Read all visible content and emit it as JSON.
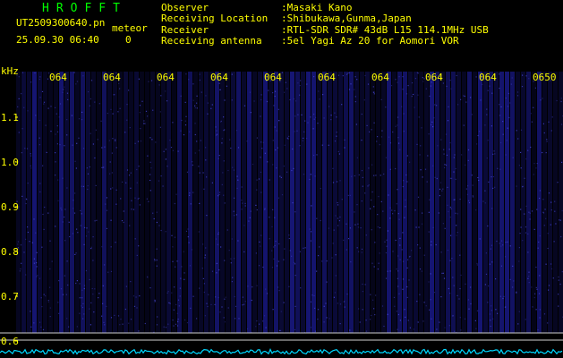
{
  "app": {
    "name": "HROFFT",
    "filename": "UT2509300640.pn",
    "tag": "meteor",
    "datetime": "25.09.30 06:40",
    "count": "0"
  },
  "info": [
    {
      "key": "Observer",
      "value": ":Masaki Kano"
    },
    {
      "key": "Receiving Location",
      "value": ":Shibukawa,Gunma,Japan"
    },
    {
      "key": "Receiver",
      "value": ":RTL-SDR SDR# 43dB L15 114.1MHz USB"
    },
    {
      "key": "Receiving antenna",
      "value": ":5el Yagi Az 20 for Aomori VOR"
    }
  ],
  "axis": {
    "unit": "kHz",
    "y_ticks": [
      "1.1",
      "1.0",
      "0.9",
      "0.8",
      "0.7",
      "0.6"
    ],
    "time_labels": [
      "064",
      "064",
      "064",
      "064",
      "064",
      "064",
      "064",
      "064",
      "064",
      "0650"
    ]
  },
  "colors": {
    "background": "#000000",
    "header_text": "#ffff00",
    "app_name": "#00ff00",
    "spectrum_noise": "#1a1a8c",
    "baseline_trace": "#00d8ff",
    "reference_line": "#d0d0d0"
  }
}
